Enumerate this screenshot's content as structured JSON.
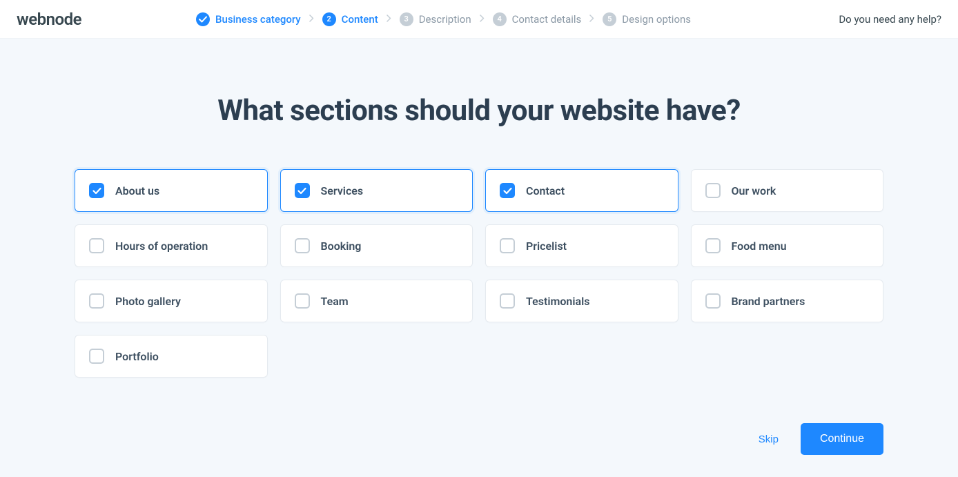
{
  "logo": "webnode",
  "steps": [
    {
      "num": "",
      "label": "Business category",
      "state": "done"
    },
    {
      "num": "2",
      "label": "Content",
      "state": "active"
    },
    {
      "num": "3",
      "label": "Description",
      "state": "pending"
    },
    {
      "num": "4",
      "label": "Contact details",
      "state": "pending"
    },
    {
      "num": "5",
      "label": "Design options",
      "state": "pending"
    }
  ],
  "help": "Do you need any help?",
  "title": "What sections should your website have?",
  "sections": [
    {
      "label": "About us",
      "checked": true
    },
    {
      "label": "Services",
      "checked": true
    },
    {
      "label": "Contact",
      "checked": true
    },
    {
      "label": "Our work",
      "checked": false
    },
    {
      "label": "Hours of operation",
      "checked": false
    },
    {
      "label": "Booking",
      "checked": false
    },
    {
      "label": "Pricelist",
      "checked": false
    },
    {
      "label": "Food menu",
      "checked": false
    },
    {
      "label": "Photo gallery",
      "checked": false
    },
    {
      "label": "Team",
      "checked": false
    },
    {
      "label": "Testimonials",
      "checked": false
    },
    {
      "label": "Brand partners",
      "checked": false
    },
    {
      "label": "Portfolio",
      "checked": false
    }
  ],
  "footer": {
    "skip": "Skip",
    "continue": "Continue"
  }
}
